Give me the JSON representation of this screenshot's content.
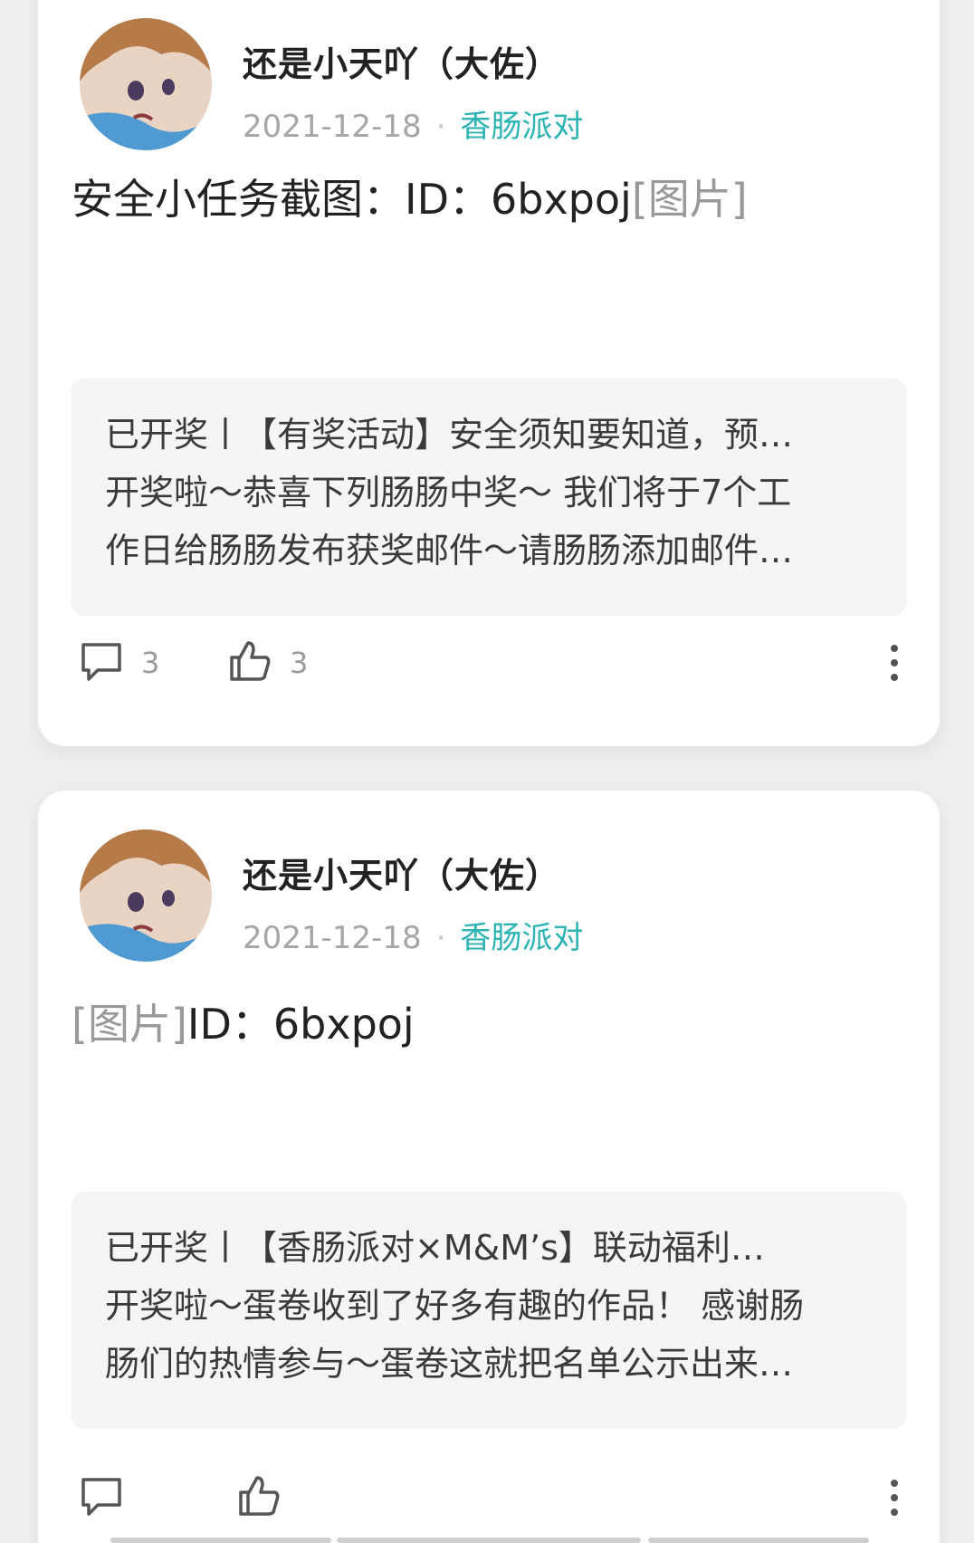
{
  "posts": [
    {
      "author": "还是小天吖（大佐）",
      "date": "2021-12-18",
      "dot": "·",
      "channel": "香肠派对",
      "content_text": "安全小任务截图：ID：6bxpoj",
      "image_tag": "[图片]",
      "quote_lines": [
        "已开奖丨【有奖活动】安全须知要知道，预…",
        "开奖啦～恭喜下列肠肠中奖～ 我们将于7个工",
        "作日给肠肠发布获奖邮件～请肠肠添加邮件…"
      ],
      "comments": "3",
      "likes": "3"
    },
    {
      "author": "还是小天吖（大佐）",
      "date": "2021-12-18",
      "dot": "·",
      "channel": "香肠派对",
      "content_text": "ID：6bxpoj",
      "image_tag": "[图片]",
      "quote_lines": [
        "已开奖丨【香肠派对×M&M’s】联动福利…",
        "开奖啦～蛋卷收到了好多有趣的作品！ 感谢肠",
        "肠们的热情参与～蛋卷这就把名单公示出来…"
      ],
      "comments": "",
      "likes": ""
    }
  ],
  "colors": {
    "channel": "#2cb3b4",
    "background": "#eeeeef",
    "card": "#ffffff",
    "quote_bg": "#f5f5f5"
  },
  "icons": [
    "avatar",
    "comment-icon",
    "like-icon",
    "more-icon"
  ]
}
